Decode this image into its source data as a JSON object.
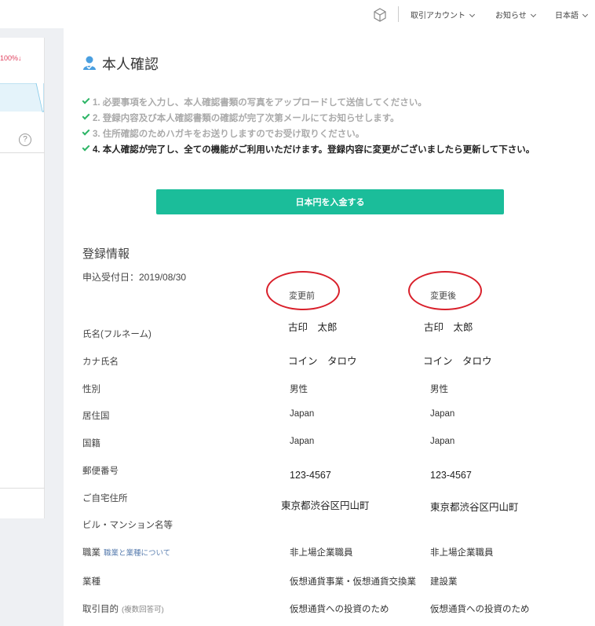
{
  "topbar": {
    "account_label": "取引アカウント",
    "news_label": "お知らせ",
    "language_label": "日本語"
  },
  "left_panel": {
    "percent_text": "100%↓",
    "help_label": "?"
  },
  "page": {
    "title": "本人確認"
  },
  "steps": [
    {
      "text": "1. 必要事項を入力し、本人確認書類の写真をアップロードして送信してください。"
    },
    {
      "text": "2. 登録内容及び本人確認書類の確認が完了次第メールにてお知らせします。"
    },
    {
      "text": "3. 住所確認のためハガキをお送りしますのでお受け取りください。"
    },
    {
      "text": "4. 本人確認が完了し、全ての機能がご利用いただけます。登録内容に変更がございましたら更新して下さい。"
    }
  ],
  "deposit_button": "日本円を入金する",
  "registration": {
    "title": "登録情報",
    "apply_date": "申込受付日：2019/08/30",
    "before_label": "変更前",
    "after_label": "変更後",
    "rows": [
      {
        "label": "氏名(フルネーム)",
        "before": "古印　太郎",
        "after": "古印　太郎"
      },
      {
        "label": "カナ氏名",
        "before": "コイン　タロウ",
        "after": "コイン　タロウ"
      },
      {
        "label": "性別",
        "before": "男性",
        "after": "男性"
      },
      {
        "label": "居住国",
        "before": "Japan",
        "after": "Japan"
      },
      {
        "label": "国籍",
        "before": "Japan",
        "after": "Japan"
      },
      {
        "label": "郵便番号",
        "before": "123-4567",
        "after": "123-4567"
      },
      {
        "label": "ご自宅住所",
        "before": "東京都渋谷区円山町",
        "after": "東京都渋谷区円山町"
      },
      {
        "label": "ビル・マンション名等",
        "before": "",
        "after": ""
      },
      {
        "label": "職業",
        "sub": "職業と業種について",
        "before": "非上場企業職員",
        "after": "非上場企業職員"
      },
      {
        "label": "業種",
        "before": "仮想通貨事業・仮想通貨交換業",
        "after": "建設業"
      },
      {
        "label": "取引目的",
        "sub": "(複数回答可)",
        "before": "仮想通貨への投資のため",
        "after": "仮想通貨への投資のため"
      }
    ]
  },
  "colors": {
    "accent": "#1bbd9a",
    "check": "#2db566",
    "annotation": "#d9202b",
    "link": "#5b7fb0"
  }
}
